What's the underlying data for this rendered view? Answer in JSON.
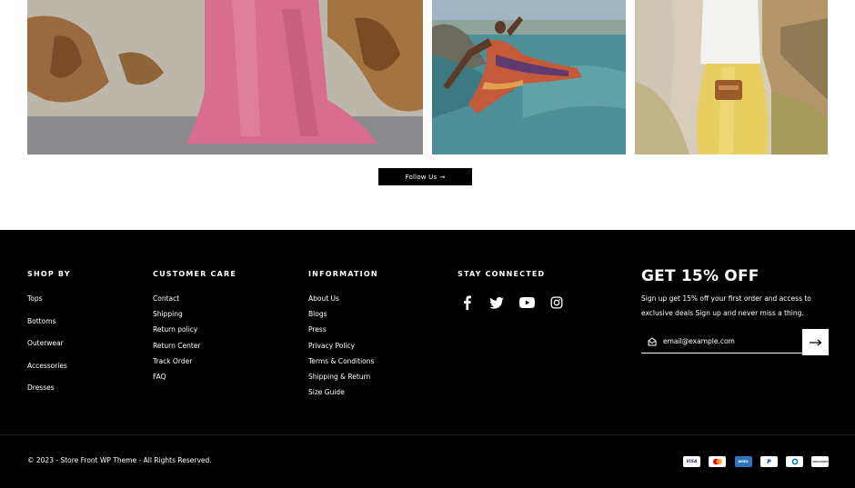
{
  "gallery": {
    "photos": [
      {
        "icon": "woman-pink-dress-photo"
      },
      {
        "icon": "woman-floating-sea-photo"
      },
      {
        "icon": "woman-yellow-skirt-photo"
      }
    ],
    "follow_label": "Follow Us",
    "follow_arrow": "→"
  },
  "footer": {
    "shop_by": {
      "heading": "SHOP BY",
      "items": [
        "Tops",
        "Bottoms",
        "Outerwear",
        "Accessories",
        "Dresses"
      ]
    },
    "customer_care": {
      "heading": "CUSTOMER CARE",
      "items": [
        "Contact",
        "Shipping",
        "Return policy",
        "Return Center",
        "Track Order",
        "FAQ"
      ]
    },
    "information": {
      "heading": "INFORMATION",
      "items": [
        "About Us",
        "Blogs",
        "Press",
        "Privacy Policy",
        "Terms & Conditions",
        "Shipping & Return",
        "Size Guide"
      ]
    },
    "stay_connected": {
      "heading": "STAY CONNECTED",
      "icons": [
        "facebook-icon",
        "twitter-icon",
        "youtube-icon",
        "instagram-icon"
      ]
    },
    "newsletter": {
      "title": "GET 15% OFF",
      "description": "Sign up get 15% off your first order and access to exclusive deals Sign up and never miss a thing.",
      "email_placeholder": "email@example.com"
    },
    "copyright": "© 2023 - Store Front WP Theme - All Rights Reserved.",
    "payments": [
      {
        "icon": "visa-card-icon",
        "label": "VISA"
      },
      {
        "icon": "mastercard-icon",
        "label": ""
      },
      {
        "icon": "amex-card-icon",
        "label": "AMEX"
      },
      {
        "icon": "paypal-card-icon",
        "label": "P"
      },
      {
        "icon": "diners-card-icon",
        "label": ""
      },
      {
        "icon": "discover-card-icon",
        "label": "DISCOVER"
      }
    ]
  },
  "colors": {
    "footer_bg": "#000000",
    "text_light": "#ffffff",
    "button_bg": "#000000",
    "pink_dress": "#d86d8f",
    "sea": "#4f8f98",
    "yellow_skirt": "#e8cf62"
  }
}
